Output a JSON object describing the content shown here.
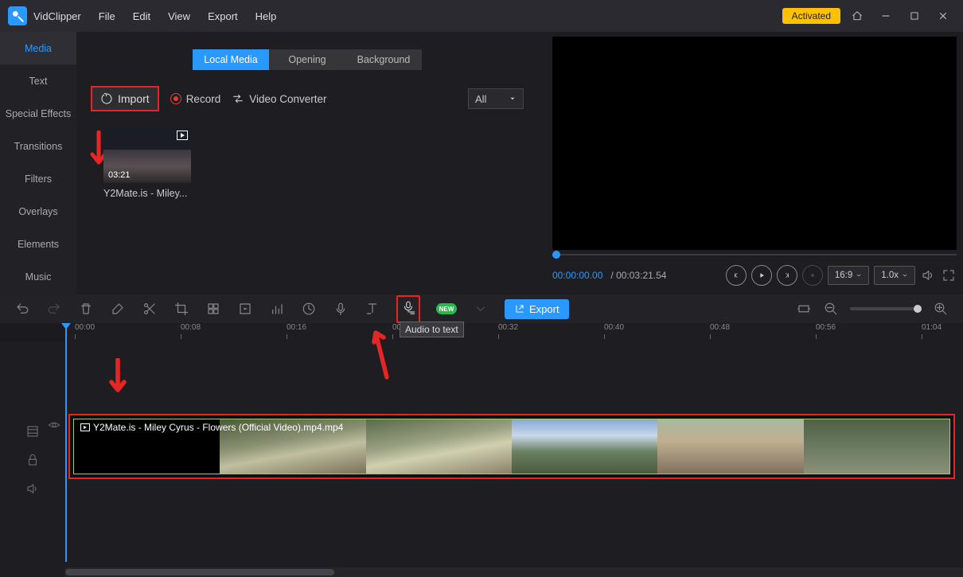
{
  "app": {
    "name": "VidClipper"
  },
  "menu": [
    "File",
    "Edit",
    "View",
    "Export",
    "Help"
  ],
  "activated_label": "Activated",
  "sidebar": [
    "Media",
    "Text",
    "Special Effects",
    "Transitions",
    "Filters",
    "Overlays",
    "Elements",
    "Music"
  ],
  "media_tabs": [
    "Local Media",
    "Opening",
    "Background"
  ],
  "actions": {
    "import": "Import",
    "record": "Record",
    "converter": "Video Converter",
    "filter_all": "All"
  },
  "clip": {
    "duration": "03:21",
    "name": "Y2Mate.is - Miley..."
  },
  "preview": {
    "current": "00:00:00.00",
    "separator": " / ",
    "total": "00:03:21.54",
    "ratio": "16:9",
    "speed": "1.0x"
  },
  "toolbar": {
    "export": "Export",
    "new_badge": "NEW",
    "tooltip": "Audio to text"
  },
  "ruler": [
    "00:00",
    "00:08",
    "00:16",
    "00:24",
    "00:32",
    "00:40",
    "00:48",
    "00:56",
    "01:04"
  ],
  "timeline_clip": {
    "title": "Y2Mate.is - Miley Cyrus - Flowers (Official Video).mp4.mp4"
  }
}
